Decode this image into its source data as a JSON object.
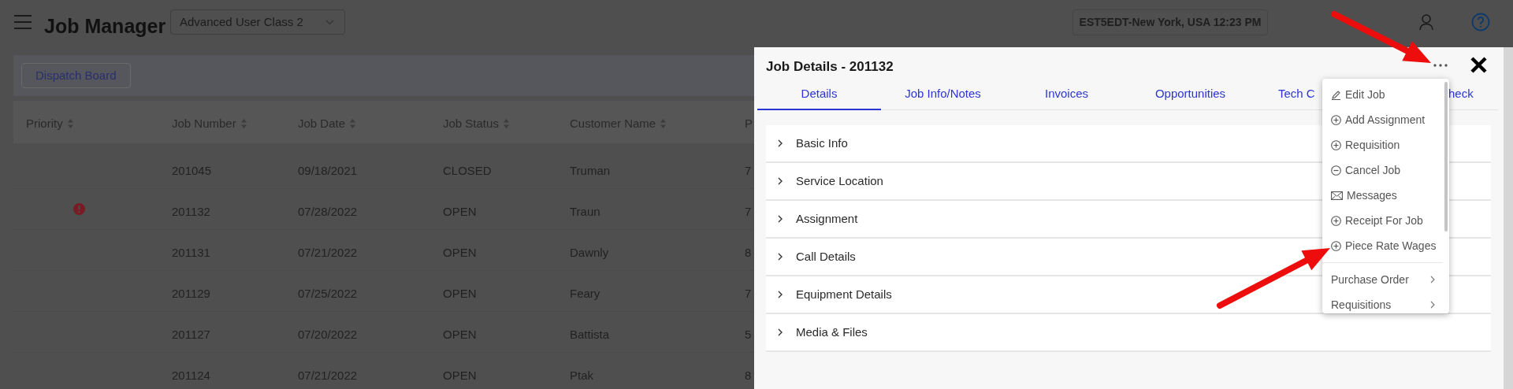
{
  "app_title": "Job Manager",
  "user_class_select": {
    "value": "Advanced User Class 2"
  },
  "timezone": "EST5EDT-New York, USA 12:23 PM",
  "toolbar": {
    "buttons": [
      "Dispatch Board"
    ]
  },
  "table": {
    "columns": [
      "Priority",
      "Job Number",
      "Job Date",
      "Job Status",
      "Customer Name",
      "P"
    ],
    "rows": [
      {
        "priority_alert": false,
        "job_number": "201045",
        "job_date": "09/18/2021",
        "job_status": "CLOSED",
        "customer_name": "Truman",
        "column_6": "7"
      },
      {
        "priority_alert": true,
        "job_number": "201132",
        "job_date": "07/28/2022",
        "job_status": "OPEN",
        "customer_name": "Traun",
        "column_6": "7"
      },
      {
        "priority_alert": false,
        "job_number": "201131",
        "job_date": "07/21/2022",
        "job_status": "OPEN",
        "customer_name": "Dawnly",
        "column_6": "8"
      },
      {
        "priority_alert": false,
        "job_number": "201129",
        "job_date": "07/25/2022",
        "job_status": "OPEN",
        "customer_name": "Feary",
        "column_6": "7"
      },
      {
        "priority_alert": false,
        "job_number": "201127",
        "job_date": "07/20/2022",
        "job_status": "OPEN",
        "customer_name": "Battista",
        "column_6": "5"
      },
      {
        "priority_alert": false,
        "job_number": "201124",
        "job_date": "07/21/2022",
        "job_status": "OPEN",
        "customer_name": "Ptak",
        "column_6": "8"
      }
    ]
  },
  "modal": {
    "title": "Job Details - 201132",
    "tabs": [
      {
        "label": "Details",
        "selected": true
      },
      {
        "label": "Job Info/Notes",
        "selected": false
      },
      {
        "label": "Invoices",
        "selected": false
      },
      {
        "label": "Opportunities",
        "selected": false
      },
      {
        "label": "Tech C",
        "selected": false
      },
      {
        "label": "heck",
        "selected": false
      }
    ],
    "sections": [
      {
        "label": "Basic Info",
        "expanded": false
      },
      {
        "label": "Service Location",
        "expanded": false
      },
      {
        "label": "Assignment",
        "expanded": false
      },
      {
        "label": "Call Details",
        "expanded": false
      },
      {
        "label": "Equipment Details",
        "expanded": false
      },
      {
        "label": "Media & Files",
        "expanded": false
      }
    ]
  },
  "actions_menu": {
    "items": [
      {
        "kind": "action",
        "label": "Edit Job"
      },
      {
        "kind": "action",
        "label": "Add Assignment"
      },
      {
        "kind": "action",
        "label": "Requisition"
      },
      {
        "kind": "action",
        "label": "Cancel Job"
      },
      {
        "kind": "action",
        "label": "Messages"
      },
      {
        "kind": "action",
        "label": "Receipt For Job"
      },
      {
        "kind": "action",
        "label": "Piece Rate Wages"
      },
      {
        "kind": "submenu",
        "label": "Purchase Order"
      },
      {
        "kind": "submenu",
        "label": "Requisitions"
      }
    ]
  }
}
